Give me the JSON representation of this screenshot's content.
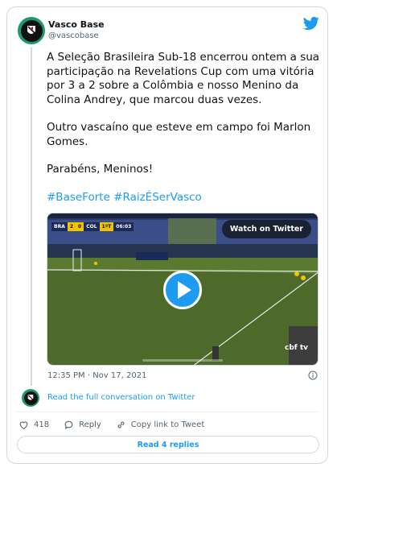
{
  "author": {
    "name": "Vasco Base",
    "handle": "@vascobase"
  },
  "tweet": {
    "paragraphs": [
      "A Seleção Brasileira Sub-18 encerrou ontem a sua participação na Revelations Cup com uma vitória por 3 a 2 sobre a Colômbia e nosso Menino da Colina Andrey, que marcou duas vezes.",
      "Outro vascaíno que esteve em campo foi Marlon Gomes.",
      "Parabéns, Meninos!"
    ],
    "hashtags": "#BaseForte #RaizÉSerVasco",
    "timestamp": "12:35 PM · Nov 17, 2021"
  },
  "media": {
    "watch_label": "Watch on Twitter",
    "scoreboard": {
      "team_a": "BRA",
      "score_a": "2",
      "score_b": "0",
      "team_b": "COL",
      "period": "1ºT",
      "clock": "06:03"
    },
    "broadcaster": "cbf tv"
  },
  "conversation": {
    "read_full_label": "Read the full conversation on Twitter"
  },
  "actions": {
    "like_count": "418",
    "reply_label": "Reply",
    "copy_label": "Copy link to Tweet"
  },
  "replies": {
    "read_label": "Read 4 replies"
  },
  "colors": {
    "accent": "#1d9bf0",
    "text": "#0f1419",
    "muted": "#536471",
    "border": "#cfd9de"
  }
}
